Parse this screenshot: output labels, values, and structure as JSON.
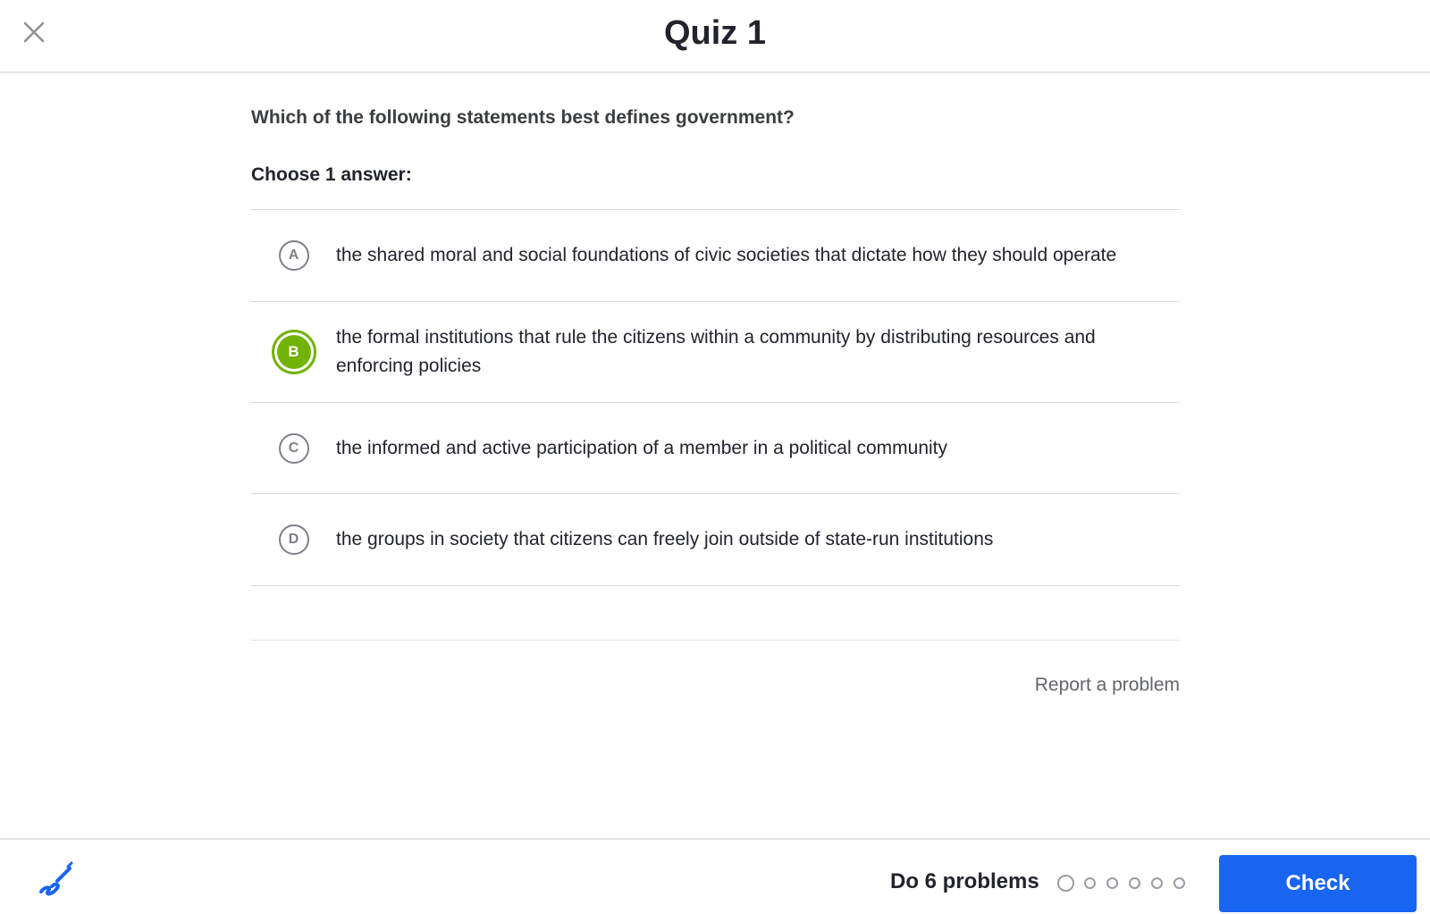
{
  "header": {
    "title": "Quiz 1",
    "close_icon": "close-icon"
  },
  "question": {
    "prompt": "Which of the following statements best defines government?",
    "instruction": "Choose 1 answer:",
    "choices": [
      {
        "letter": "A",
        "text": "the shared moral and social foundations of civic societies that dictate how they should operate",
        "selected": false
      },
      {
        "letter": "B",
        "text": "the formal institutions that rule the citizens within a community by distributing resources and enforcing policies",
        "selected": true
      },
      {
        "letter": "C",
        "text": "the informed and active participation of a member in a political community",
        "selected": false
      },
      {
        "letter": "D",
        "text": "the groups in society that citizens can freely join outside of state-run institutions",
        "selected": false
      }
    ],
    "report_link": "Report a problem"
  },
  "footer": {
    "scratchpad_icon": "scratchpad-pencil-icon",
    "progress_label": "Do 6 problems",
    "problem_count": 6,
    "completed": 0,
    "check_label": "Check"
  },
  "colors": {
    "accent_blue": "#1865f2",
    "selected_green": "#71b307",
    "text_dark": "#21242c",
    "border": "#d6d8da"
  }
}
